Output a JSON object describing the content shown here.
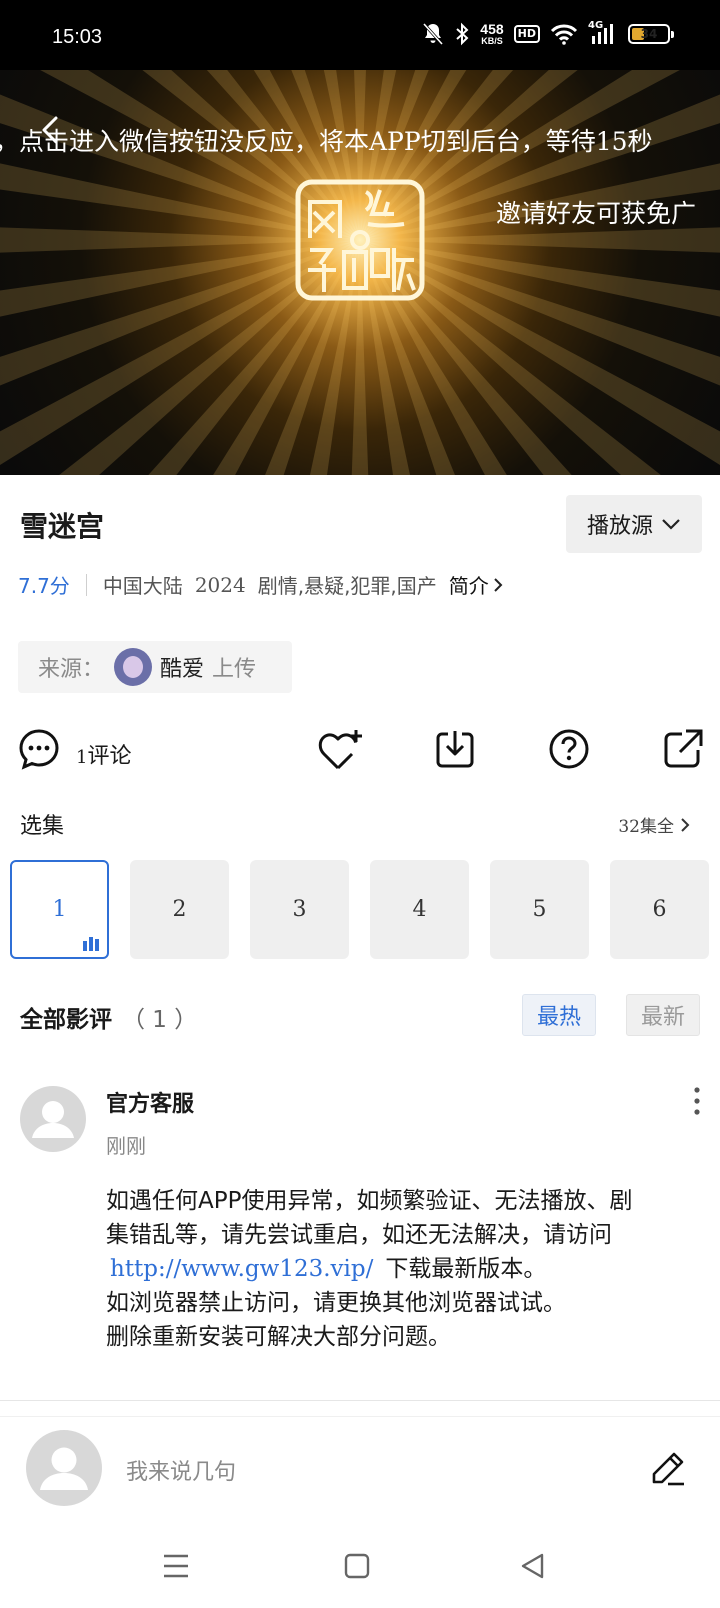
{
  "status_bar": {
    "time": "15:03",
    "net_speed_value": "458",
    "net_speed_unit": "KB/S",
    "hd_label": "HD",
    "signal_label": "4G",
    "battery_level": "34",
    "battery_fraction": 0.34
  },
  "video": {
    "marquee_text": "，点击进入微信按钮没反应，将本APP切到后台，等待15秒",
    "invite_text": "邀请好友可获免广"
  },
  "title": "雪迷宫",
  "source_button": "播放源",
  "meta": {
    "score": "7.7分",
    "region": "中国大陆",
    "year": "2024",
    "genres": "剧情,悬疑,犯罪,国产",
    "intro_label": "简介"
  },
  "uploader": {
    "source_label": "来源：",
    "name": "酷爱",
    "action": "上传"
  },
  "actions": {
    "comment_count": "1",
    "comment_label": "评论"
  },
  "episodes": {
    "title": "选集",
    "total_count": "32",
    "total_label": "集全",
    "items": [
      "1",
      "2",
      "3",
      "4",
      "5",
      "6"
    ]
  },
  "reviews": {
    "title": "全部影评",
    "count": "（ 1 ）",
    "sort_hot": "最热",
    "sort_new": "最新",
    "items": [
      {
        "author": "官方客服",
        "time": "刚刚",
        "line1": "如遇任何APP使用异常，如频繁验证、无法播放、剧",
        "line2": "集错乱等，请先尝试重启，如还无法解决，请访问",
        "link": "http://www.gw123.vip/",
        "line3_suffix": "下载最新版本。",
        "line4": "如浏览器禁止访问，请更换其他浏览器试试。",
        "line5": "删除重新安装可解决大部分问题。"
      }
    ]
  },
  "comment_input": {
    "placeholder": "我来说几句"
  },
  "colors": {
    "accent": "#2f6fd6",
    "battery": "#e2a82f"
  }
}
